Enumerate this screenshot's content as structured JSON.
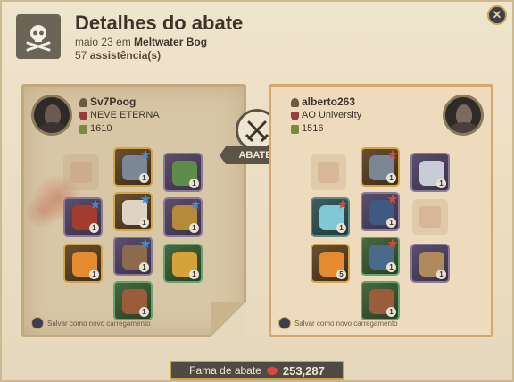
{
  "header": {
    "title": "Detalhes do abate",
    "date": "maio 23 em",
    "location": "Meltwater Bog",
    "assists_count": "57",
    "assists_label": "assistência(s)",
    "close_label": "✕"
  },
  "center": {
    "result_label": "ABATEU"
  },
  "killer": {
    "name": "Sv7Poog",
    "guild": "NEVE ETERNA",
    "item_power": "1610",
    "slots": [
      {
        "item": "helmet",
        "qty": "1",
        "tier": "",
        "enchant": "blue"
      },
      {
        "item": "cape",
        "qty": "1",
        "tier": "",
        "enchant": ""
      },
      {
        "item": "weapon",
        "qty": "1",
        "tier": "",
        "enchant": "blue"
      },
      {
        "item": "armor",
        "qty": "1",
        "tier": "",
        "enchant": "blue"
      },
      {
        "item": "offhand",
        "qty": "1",
        "tier": "",
        "enchant": "blue"
      },
      {
        "item": "potion",
        "qty": "1",
        "tier": "",
        "enchant": ""
      },
      {
        "item": "boots",
        "qty": "1",
        "tier": "",
        "enchant": "blue"
      },
      {
        "item": "food",
        "qty": "1",
        "tier": "",
        "enchant": ""
      },
      {
        "item": "mount",
        "qty": "1",
        "tier": "",
        "enchant": ""
      }
    ],
    "save_label": "Salvar como novo carregamento"
  },
  "victim": {
    "name": "alberto263",
    "guild": "AO University",
    "item_power": "1516",
    "slots": [
      {
        "item": "helmet",
        "qty": "1",
        "tier": "",
        "enchant": "red"
      },
      {
        "item": "cape",
        "qty": "1",
        "tier": "",
        "enchant": ""
      },
      {
        "item": "weapon",
        "qty": "1",
        "tier": "",
        "enchant": "red"
      },
      {
        "item": "armor",
        "qty": "1",
        "tier": "",
        "enchant": "red"
      },
      {
        "item": "offhand",
        "qty": "",
        "tier": "",
        "enchant": ""
      },
      {
        "item": "potion",
        "qty": "5",
        "tier": "",
        "enchant": ""
      },
      {
        "item": "boots",
        "qty": "1",
        "tier": "",
        "enchant": "red"
      },
      {
        "item": "food",
        "qty": "1",
        "tier": "",
        "enchant": ""
      },
      {
        "item": "mount",
        "qty": "1",
        "tier": "",
        "enchant": ""
      }
    ],
    "save_label": "Salvar como novo carregamento"
  },
  "fame": {
    "label": "Fama de abate",
    "value": "253,287"
  },
  "colors": {
    "accent_gold": "#c9a24a",
    "enchant_blue": "#3a8fd9",
    "enchant_red": "#d94a3a"
  }
}
